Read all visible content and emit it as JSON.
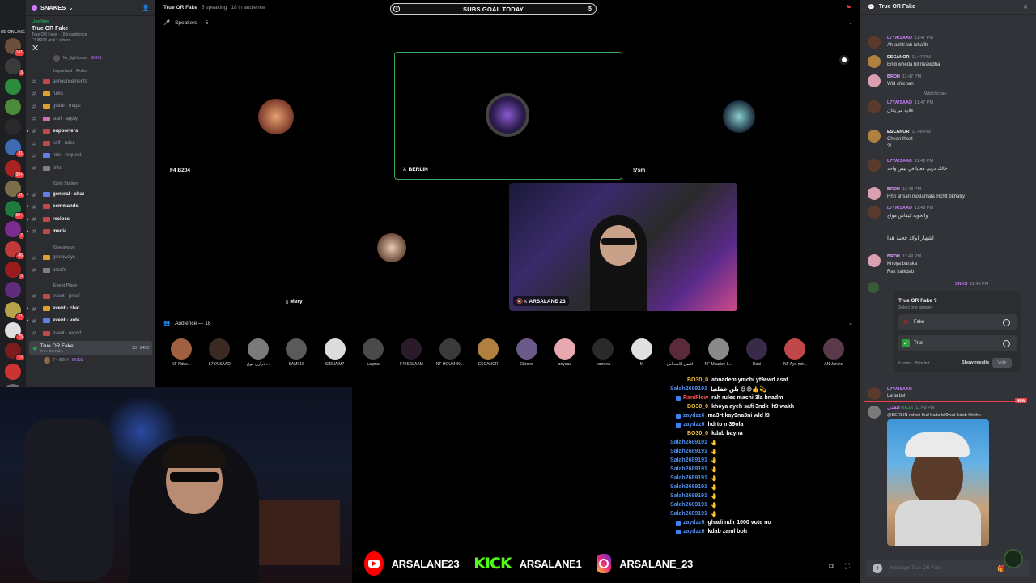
{
  "rail": {
    "online_label": "85 ONLINE",
    "servers": [
      {
        "color": "#6b4f3a",
        "badge": "141"
      },
      {
        "color": "#3a3a3a",
        "badge": "3"
      },
      {
        "color": "#2c8c3c",
        "badge": ""
      },
      {
        "color": "#4b8b3b",
        "badge": ""
      },
      {
        "color": "#2a2a2a",
        "badge": ""
      },
      {
        "color": "#3d6ab3",
        "badge": "31"
      },
      {
        "color": "#a82222",
        "badge": "99+"
      },
      {
        "color": "#7b6c4a",
        "badge": "11"
      },
      {
        "color": "#1f7a3f",
        "badge": "99+"
      },
      {
        "color": "#7b2d8f",
        "badge": "2"
      },
      {
        "color": "#c03a3a",
        "badge": "46"
      },
      {
        "color": "#9b1c1c",
        "badge": "3"
      },
      {
        "color": "#5f2c7a",
        "badge": ""
      },
      {
        "color": "#b6a24a",
        "badge": "71"
      },
      {
        "color": "#dfdfdf",
        "badge": "75"
      },
      {
        "color": "#7a1c1c",
        "badge": "72"
      },
      {
        "color": "#cc3333",
        "badge": ""
      },
      {
        "color": "#6a6a6a",
        "badge": "99+"
      }
    ]
  },
  "sidebar": {
    "server_name": "SNAKES",
    "live_badge": "Live Now",
    "live_title": "True OR Fake",
    "live_sub": "True OR Fake · 18 in audience",
    "live_members": "F4 B204 and 4 others",
    "live_member_extra": "Mr_lighttouse",
    "live_member_tag": "SNKS",
    "categories": {
      "important": "Important · Roles",
      "gold": "Gold Station",
      "giveaways": "Giveaways",
      "event": "Event Place"
    },
    "channels": [
      {
        "label": "announcements",
        "bold": false,
        "color": "#c04848"
      },
      {
        "label": "rules",
        "bold": false,
        "color": "#e0a030"
      },
      {
        "label": "guide · maps",
        "bold": false,
        "color": "#e0a030"
      },
      {
        "label": "staff · apply",
        "bold": false,
        "color": "#d070b0"
      },
      {
        "label": "supporters",
        "bold": true,
        "color": "#c04848"
      },
      {
        "label": "self · roles",
        "bold": false,
        "color": "#c04848"
      },
      {
        "label": "role · request",
        "bold": false,
        "color": "#6080e0"
      },
      {
        "label": "links",
        "bold": false,
        "color": "#808080"
      },
      {
        "label": "general · chat",
        "bold": true,
        "color": "#6080e0"
      },
      {
        "label": "commands",
        "bold": true,
        "color": "#c04848"
      },
      {
        "label": "recipes",
        "bold": true,
        "color": "#c04848"
      },
      {
        "label": "media",
        "bold": true,
        "color": "#c04848"
      },
      {
        "label": "giveaways",
        "bold": false,
        "color": "#e0a030"
      },
      {
        "label": "proofs",
        "bold": false,
        "color": "#808080"
      },
      {
        "label": "event · proof",
        "bold": false,
        "color": "#c04848"
      },
      {
        "label": "event · chat",
        "bold": true,
        "color": "#e0a030"
      },
      {
        "label": "event · vote",
        "bold": true,
        "color": "#6080e0"
      },
      {
        "label": "event · report",
        "bold": false,
        "color": "#c04848"
      }
    ],
    "stage_channel": {
      "label": "True OR Fake",
      "sub": "True OR Fake",
      "count": "23",
      "count2": "2400"
    },
    "stage_member": "F4 B204",
    "stage_member_tag": "SNKS"
  },
  "stage": {
    "title": "True OR Fake",
    "speaking": "5 speaking",
    "audience_count": "18 in audience",
    "goal_text": "SUBS GOAL TODAY",
    "goal_left": "0",
    "goal_right": "5",
    "speakers_label": "Speakers — 5",
    "audience_label": "Audience — 18",
    "speakers": [
      {
        "name": "F4 B204",
        "bg": "#5e4234"
      },
      {
        "name": "BERLIN",
        "bg": "#2a2a2a"
      },
      {
        "name": "!7sm",
        "bg": "#2d2d2d"
      },
      {
        "name": "Mery",
        "bg": "#54423b"
      },
      {
        "name": "ARSALANE 23",
        "bg": "#1c1a3c"
      }
    ],
    "audience": [
      {
        "name": "NF Ndus...",
        "color": "#a06040"
      },
      {
        "name": "L7YA!SAAD",
        "color": "#3a2a22"
      },
      {
        "name": "دراري فوق ...",
        "color": "#7a7a7a"
      },
      {
        "name": "SAMI 16",
        "color": "#5a5a5a"
      },
      {
        "name": "SIDNA M7",
        "color": "#dcdcdc"
      },
      {
        "name": "Lagma",
        "color": "#4a4a4a"
      },
      {
        "name": "F4 ISSLAAM",
        "color": "#2a1a2a"
      },
      {
        "name": "NF HOUM4N...",
        "color": "#3a3a3a"
      },
      {
        "name": "ESCANOR",
        "color": "#b08040"
      },
      {
        "name": "Chrono",
        "color": "#6a5a8a"
      },
      {
        "name": "anyaaa",
        "color": "#e8a8b0"
      },
      {
        "name": "namrea",
        "color": "#2a2a2a"
      },
      {
        "name": "M",
        "color": "#e0e0e0"
      },
      {
        "name": "افضل الاشخاص",
        "color": "#5a2a3a"
      },
      {
        "name": "NF Maurice L...",
        "color": "#8a8a8a"
      },
      {
        "name": "Dabi",
        "color": "#3a2a4a"
      },
      {
        "name": "NF Aya not...",
        "color": "#c04848"
      },
      {
        "name": "AN Janine",
        "color": "#5a3a4a"
      }
    ]
  },
  "chat_overlay": [
    {
      "user": "BO30_0",
      "color": "#f6c445",
      "text": "abnadem ymchi yt9ewd asat",
      "icon": false
    },
    {
      "user": "Salah2689191",
      "color": "#4f8de8",
      "text": "بلن غفلتيا 😄😄👍💫",
      "icon": false
    },
    {
      "user": "RaniFlow",
      "color": "#ff5555",
      "text": "rah rules machi 3la bnadm",
      "icon": true
    },
    {
      "user": "BO30_0",
      "color": "#f6c445",
      "text": "khoya ayeh safi 3ndk lh9 wakh",
      "icon": false
    },
    {
      "user": "zaydzz6",
      "color": "#4f8de8",
      "text": "ma3rt kay9na3ni wld l9",
      "icon": true
    },
    {
      "user": "zaydzz6",
      "color": "#4f8de8",
      "text": "hdrto m39ola",
      "icon": true
    },
    {
      "user": "BO30_0",
      "color": "#f6c445",
      "text": "kdab bayna",
      "icon": false
    },
    {
      "user": "Salah2689191",
      "color": "#4f8de8",
      "text": "🤚",
      "icon": false
    },
    {
      "user": "Salah2689191",
      "color": "#4f8de8",
      "text": "🤚",
      "icon": false
    },
    {
      "user": "Salah2689191",
      "color": "#4f8de8",
      "text": "🤚",
      "icon": false
    },
    {
      "user": "Salah2689191",
      "color": "#4f8de8",
      "text": "🤚",
      "icon": false
    },
    {
      "user": "Salah2689191",
      "color": "#4f8de8",
      "text": "🤚",
      "icon": false
    },
    {
      "user": "Salah2689191",
      "color": "#4f8de8",
      "text": "🤚",
      "icon": false
    },
    {
      "user": "Salah2689191",
      "color": "#4f8de8",
      "text": "🤚",
      "icon": false
    },
    {
      "user": "Salah2689191",
      "color": "#4f8de8",
      "text": "🤚",
      "icon": false
    },
    {
      "user": "Salah2689191",
      "color": "#4f8de8",
      "text": "🤚",
      "icon": false
    },
    {
      "user": "zaydzz6",
      "color": "#4f8de8",
      "text": "ghadi ndir 1000 vote no",
      "icon": true
    },
    {
      "user": "zaydzz6",
      "color": "#4f8de8",
      "text": "kdab zaml boh",
      "icon": true
    }
  ],
  "socials": {
    "youtube": "ARSALANE23",
    "kick_logo": "KICK",
    "kick": "ARSALANE1",
    "instagram": "ARSALANE_23"
  },
  "rpanel": {
    "title": "True OR Fake",
    "messages": [
      {
        "user": "L7YA!SAAD",
        "color": "#c77dff",
        "time": "11:47 PM",
        "text": "Ah akhti lah ichafih",
        "av": "#5a3a2a"
      },
      {
        "user": "ESCANOR",
        "color": "#f2f3f5",
        "time": "11:47 PM",
        "text": "Endi wheda bit neawdha",
        "av": "#b08040"
      },
      {
        "user": "BRDH",
        "color": "#e0a0ff",
        "time": "11:47 PM",
        "text": "Wld chichan",
        "av": "#d8a0b0"
      },
      {
        "user": "L7YA!SAAD",
        "color": "#c77dff",
        "time": "11:47 PM",
        "text": "علاية ميريكان",
        "av": "#5a3a2a"
      },
      {
        "user": "ESCANOR",
        "color": "#f2f3f5",
        "time": "11:48 PM",
        "text": "Chkon lhost",
        "av": "#b08040"
      },
      {
        "user": "L7YA!SAAD",
        "color": "#c77dff",
        "time": "11:48 PM",
        "text": "خالك دربي معايا في بيض واحد",
        "av": "#5a3a2a"
      },
      {
        "user": "BRDH",
        "color": "#e0a0ff",
        "time": "11:48 PM",
        "text": "Hhh ahsan mo3amala mchit bkhatry",
        "av": "#d8a0b0"
      },
      {
        "user": "L7YA!SAAD",
        "color": "#c77dff",
        "time": "11:48 PM",
        "text": "والخوية كيفاش مواح",
        "av": "#5a3a2a"
      },
      {
        "user": "BRDH",
        "color": "#e0a0ff",
        "time": "11:49 PM",
        "text": "Khoya baraka",
        "av": "#d8a0b0"
      }
    ],
    "arabic_line": "اشهار اولاد قحبة هذا",
    "extra_line": "?!",
    "reply_ref": "Wld chichan",
    "rak_line": "Rak katkdab",
    "poll_sender": "SNKS",
    "poll_time": "11:49 PM",
    "poll_question": "True OR Fake ?",
    "poll_select": "Select one answer",
    "poll_options": [
      {
        "label": "Fake",
        "icon": "x-icon",
        "icon_color": "#c62828"
      },
      {
        "label": "True",
        "icon": "check-icon",
        "icon_color": "#2e9e3a"
      }
    ],
    "poll_votes": "6 votes",
    "poll_left": "58m left",
    "poll_show": "Show results",
    "poll_vote": "Vote",
    "after_poll_user": "L7YA!SAAD",
    "after_poll_text": "La la bsh",
    "reply_user": "الفتى",
    "reply_tag": "RAJA",
    "reply_time": "11:49 PM",
    "reply_text": "@BERLIN rahwli fhal hada bil9wat lkdob hhhhh",
    "new_label": "NEW",
    "input_placeholder": "Message True OR Fake"
  }
}
